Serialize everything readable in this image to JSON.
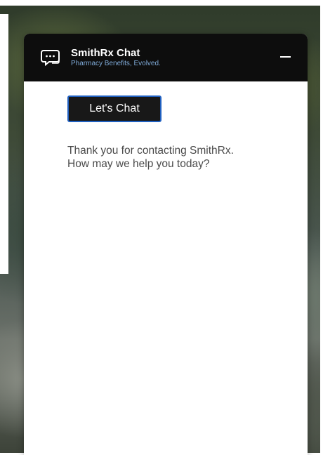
{
  "header": {
    "title": "SmithRx Chat",
    "subtitle": "Pharmacy Benefits, Evolved.",
    "icon": "chat-bubble-icon",
    "minimize_icon": "minimize-icon"
  },
  "body": {
    "button_label": "Let's Chat",
    "welcome_lines": [
      "Thank you for contacting SmithRx.",
      "How may we help you today?"
    ]
  },
  "colors": {
    "header_bg": "#0d0d0d",
    "subtitle": "#7ea9d6",
    "button_border": "#1f5fbf",
    "button_bg": "#181818",
    "body_text": "#4a4a4a"
  }
}
